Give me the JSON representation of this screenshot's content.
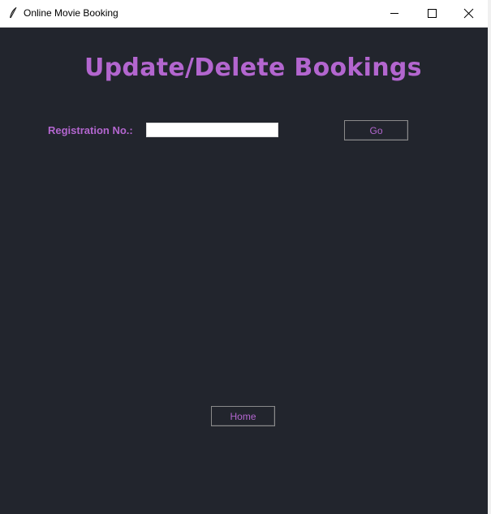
{
  "window": {
    "title": "Online Movie Booking"
  },
  "page": {
    "heading": "Update/Delete Bookings",
    "registration_label": "Registration No.:",
    "registration_value": "",
    "go_label": "Go",
    "home_label": "Home"
  },
  "icons": {
    "app": "feather-icon",
    "minimize": "minimize-icon",
    "maximize": "maximize-icon",
    "close": "close-icon"
  },
  "colors": {
    "background": "#22252d",
    "accent": "#b366cf",
    "titlebar": "#ffffff"
  }
}
